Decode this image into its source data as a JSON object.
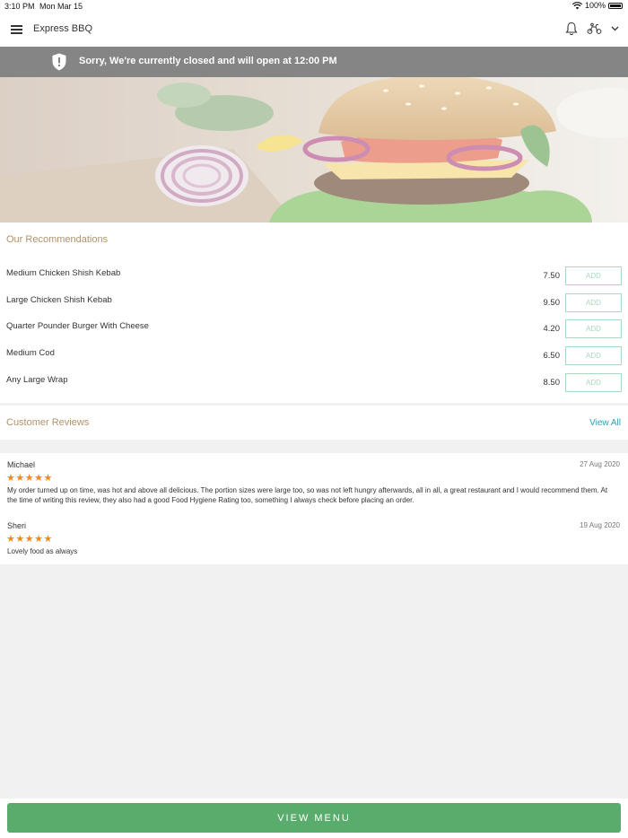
{
  "status_bar": {
    "time": "3:10 PM",
    "date": "Mon Mar 15",
    "battery": "100%"
  },
  "header": {
    "title": "Express BBQ"
  },
  "banner": {
    "message": "Sorry, We're currently closed and will open at 12:00 PM"
  },
  "recommendations": {
    "title": "Our Recommendations",
    "items": [
      {
        "name": "Medium Chicken Shish Kebab",
        "price": "7.50",
        "button": "ADD"
      },
      {
        "name": "Large Chicken Shish Kebab",
        "price": "9.50",
        "button": "ADD"
      },
      {
        "name": "Quarter Pounder Burger With Cheese",
        "price": "4.20",
        "button": "ADD"
      },
      {
        "name": "Medium Cod",
        "price": "6.50",
        "button": "ADD"
      },
      {
        "name": "Any Large Wrap",
        "price": "8.50",
        "button": "ADD"
      }
    ]
  },
  "reviews": {
    "title": "Customer Reviews",
    "view_all": "View All",
    "items": [
      {
        "name": "Michael",
        "date": "27 Aug 2020",
        "rating": 5,
        "stars": "★★★★★",
        "text": "My order turned up on time, was hot and above all delicious. The portion sizes were large too, so was not left hungry afterwards, all in all, a great restaurant and I would recommend them. At the time of writing this review, they also had a good Food Hygiene Rating too, something I always check before placing an order."
      },
      {
        "name": "Sheri",
        "date": "19 Aug 2020",
        "rating": 5,
        "stars": "★★★★★",
        "text": "Lovely food as always"
      }
    ]
  },
  "footer": {
    "view_menu": "VIEW MENU"
  },
  "colors": {
    "accent_green": "#5aac6d",
    "link_blue": "#2e9bb6",
    "section_gold": "#b0926a",
    "star_orange": "#f08a1a",
    "banner_gray": "#858585"
  },
  "icons": [
    "menu-icon",
    "bell-icon",
    "delivery-scooter-icon",
    "chevron-down-icon",
    "shield-alert-icon",
    "wifi-icon",
    "battery-icon"
  ]
}
